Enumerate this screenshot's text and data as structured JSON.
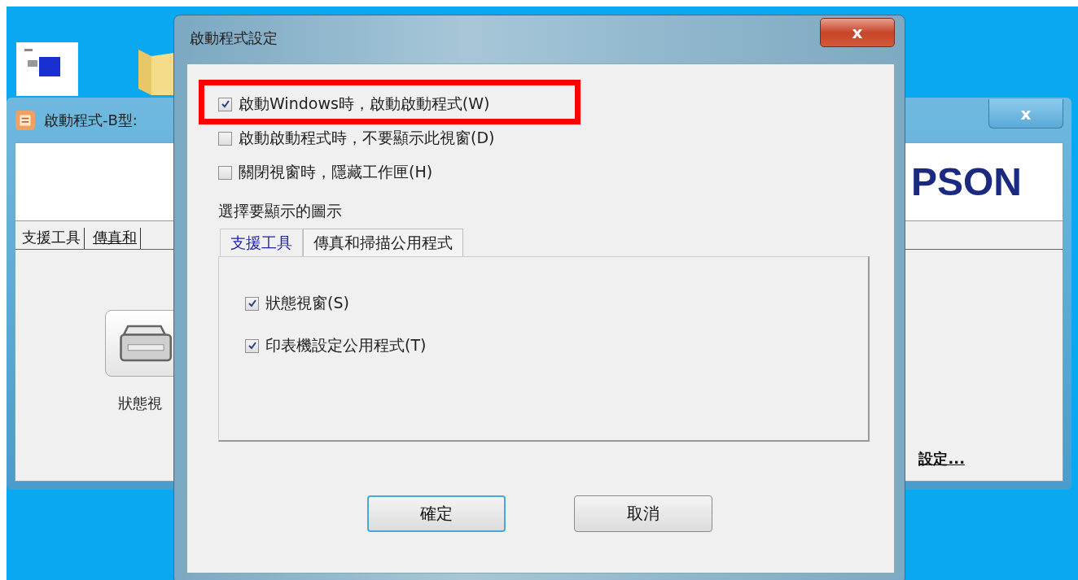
{
  "background_window": {
    "title": "啟動程式-B型:",
    "close": "x",
    "logo": "PSON",
    "tabs": [
      {
        "label": "支援工具",
        "selected": true
      },
      {
        "label": "傳真和",
        "selected": false
      }
    ],
    "tool_label": "狀態視",
    "link": "設定..."
  },
  "dialog": {
    "title": "啟動程式設定",
    "close": "x",
    "options": [
      {
        "label": "啟動Windows時，啟動啟動程式(W)",
        "checked": true
      },
      {
        "label": "啟動啟動程式時，不要顯示此視窗(D)",
        "checked": false
      },
      {
        "label": "關閉視窗時，隱藏工作匣(H)",
        "checked": false
      }
    ],
    "section_label": "選擇要顯示的圖示",
    "tabs": [
      {
        "label": "支援工具",
        "selected": true
      },
      {
        "label": "傳真和掃描公用程式",
        "selected": false
      }
    ],
    "tab_options": [
      {
        "label": "狀態視窗(S)",
        "checked": true
      },
      {
        "label": "印表機設定公用程式(T)",
        "checked": true
      }
    ],
    "buttons": [
      {
        "label": "確定",
        "default": true
      },
      {
        "label": "取消",
        "default": false
      }
    ]
  }
}
